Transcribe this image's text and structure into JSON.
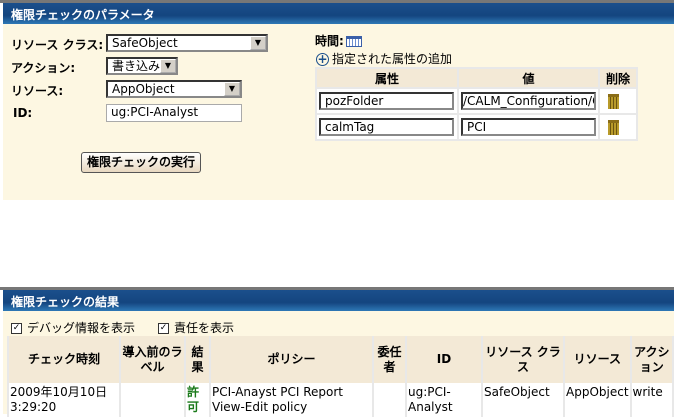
{
  "params": {
    "title": "権限チェックのパラメータ",
    "resource_class_label": "リソース クラス:",
    "resource_class_value": "SafeObject",
    "action_label": "アクション:",
    "action_value": "書き込み",
    "resource_label": "リソース:",
    "resource_value": "AppObject",
    "id_label": "ID:",
    "id_value": "ug:PCI-Analyst",
    "run_button": "権限チェックの実行",
    "time_label": "時間:",
    "add_attr": "指定された属性の追加",
    "attr_headers": [
      "属性",
      "値",
      "削除"
    ],
    "attrs": [
      {
        "name": "pozFolder",
        "value": "/CALM_Configuration/C"
      },
      {
        "name": "calmTag",
        "value": "PCI"
      }
    ]
  },
  "results": {
    "title": "権限チェックの結果",
    "debug_label": "デバッグ情報を表示",
    "resp_label": "責任を表示",
    "headers": [
      "チェック時刻",
      "導入前のラベル",
      "結果",
      "ポリシー",
      "委任者",
      "ID",
      "リソース クラス",
      "リソース",
      "アクション"
    ],
    "rows": [
      {
        "time": "2009年10月10日 3:29:20",
        "label": "",
        "result": "許可",
        "policy": "PCI-Anayst PCI Report View-Edit policy",
        "delegator": "",
        "id": "ug:PCI-Analyst",
        "resource_class": "SafeObject",
        "resource": "AppObject",
        "action": "write"
      }
    ]
  }
}
